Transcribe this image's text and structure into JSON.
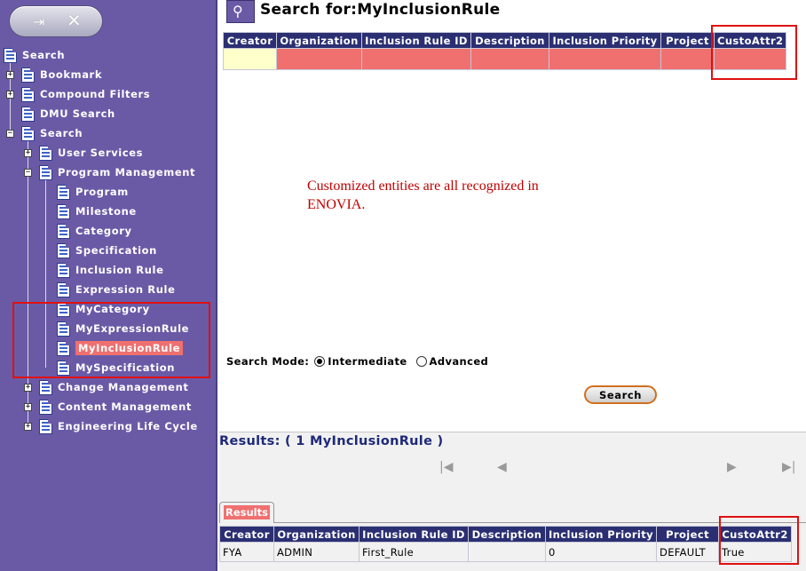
{
  "sidebar": {
    "root_label": "Search",
    "items": [
      {
        "label": "Bookmark"
      },
      {
        "label": "Compound Filters"
      },
      {
        "label": "DMU Search"
      },
      {
        "label": "Search"
      },
      {
        "label": "User Services"
      },
      {
        "label": "Program Management"
      },
      {
        "label": "Program"
      },
      {
        "label": "Milestone"
      },
      {
        "label": "Category"
      },
      {
        "label": "Specification"
      },
      {
        "label": "Inclusion Rule"
      },
      {
        "label": "Expression Rule"
      },
      {
        "label": "MyCategory"
      },
      {
        "label": "MyExpressionRule"
      },
      {
        "label": "MyInclusionRule",
        "selected": true
      },
      {
        "label": "MySpecification"
      },
      {
        "label": "Change Management"
      },
      {
        "label": "Content Management"
      },
      {
        "label": "Engineering Life Cycle"
      }
    ]
  },
  "header": {
    "title": "Search for:MyInclusionRule"
  },
  "search_table": {
    "columns": [
      "Creator",
      "Organization",
      "Inclusion Rule ID",
      "Description",
      "Inclusion Priority",
      "Project",
      "CustoAttr2"
    ]
  },
  "annotation": {
    "text": "Customized entities are all recognized in ENOVIA."
  },
  "search_mode": {
    "label": "Search Mode:",
    "options": [
      "Intermediate",
      "Advanced"
    ],
    "selected": "Intermediate"
  },
  "search_button": "Search",
  "results": {
    "title": "Results: ( 1 MyInclusionRule )",
    "tab_label": "Results",
    "columns": [
      "Creator",
      "Organization",
      "Inclusion Rule ID",
      "Description",
      "Inclusion Priority",
      "Project",
      "CustoAttr2"
    ],
    "rows": [
      [
        "FYA",
        "ADMIN",
        "First_Rule",
        "",
        "0",
        "DEFAULT",
        "True"
      ]
    ]
  },
  "icons": {
    "first_page": "first-page-icon",
    "prev_page": "prev-page-icon",
    "next_page": "next-page-icon",
    "last_page": "last-page-icon"
  },
  "colors": {
    "sidebar_bg": "#6a5aa6",
    "header_bg": "#2b2f72",
    "highlight": "#f07070",
    "annotation_box": "#e01010",
    "annotation_text": "#c00000"
  }
}
